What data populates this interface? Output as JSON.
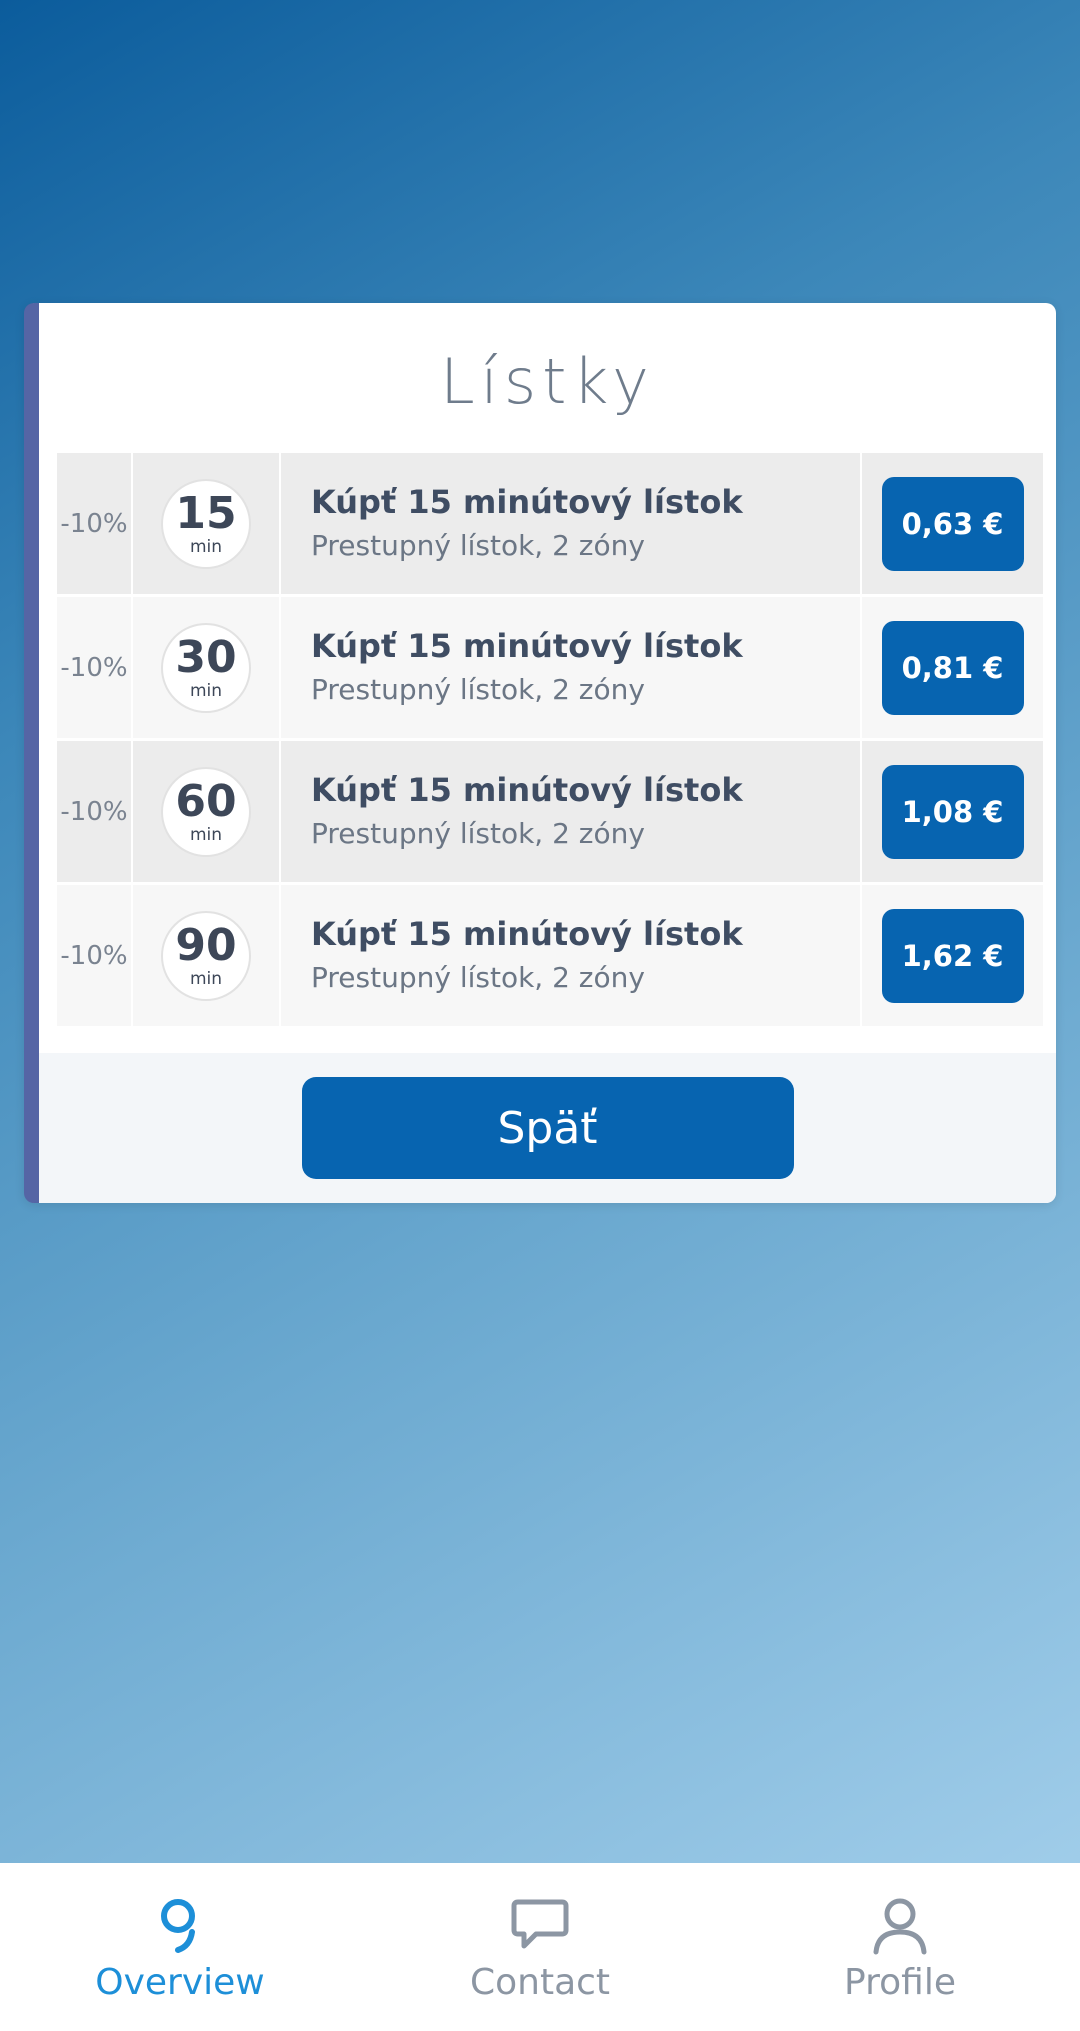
{
  "card": {
    "title": "Lístky",
    "tickets": [
      {
        "discount": "-10%",
        "minutes": "15",
        "unit": "min",
        "title": "Kúpť 15 minútový lístok",
        "subtitle": "Prestupný lístok, 2 zóny",
        "price": "0,63 €"
      },
      {
        "discount": "-10%",
        "minutes": "30",
        "unit": "min",
        "title": "Kúpť 15 minútový lístok",
        "subtitle": "Prestupný lístok, 2 zóny",
        "price": "0,81 €"
      },
      {
        "discount": "-10%",
        "minutes": "60",
        "unit": "min",
        "title": "Kúpť 15 minútový lístok",
        "subtitle": "Prestupný lístok, 2 zóny",
        "price": "1,08 €"
      },
      {
        "discount": "-10%",
        "minutes": "90",
        "unit": "min",
        "title": "Kúpť 15 minútový lístok",
        "subtitle": "Prestupný lístok, 2 zóny",
        "price": "1,62 €"
      }
    ],
    "back_label": "Späť"
  },
  "nav": {
    "items": [
      {
        "label": "Overview",
        "icon": "overview-icon",
        "active": true
      },
      {
        "label": "Contact",
        "icon": "chat-bubble-icon",
        "active": false
      },
      {
        "label": "Profile",
        "icon": "user-icon",
        "active": false
      }
    ]
  },
  "colors": {
    "primary_button": "#0764b0",
    "active_nav": "#1d8fd8",
    "inactive_nav": "#8c96a3",
    "card_accent": "#5565a5"
  }
}
